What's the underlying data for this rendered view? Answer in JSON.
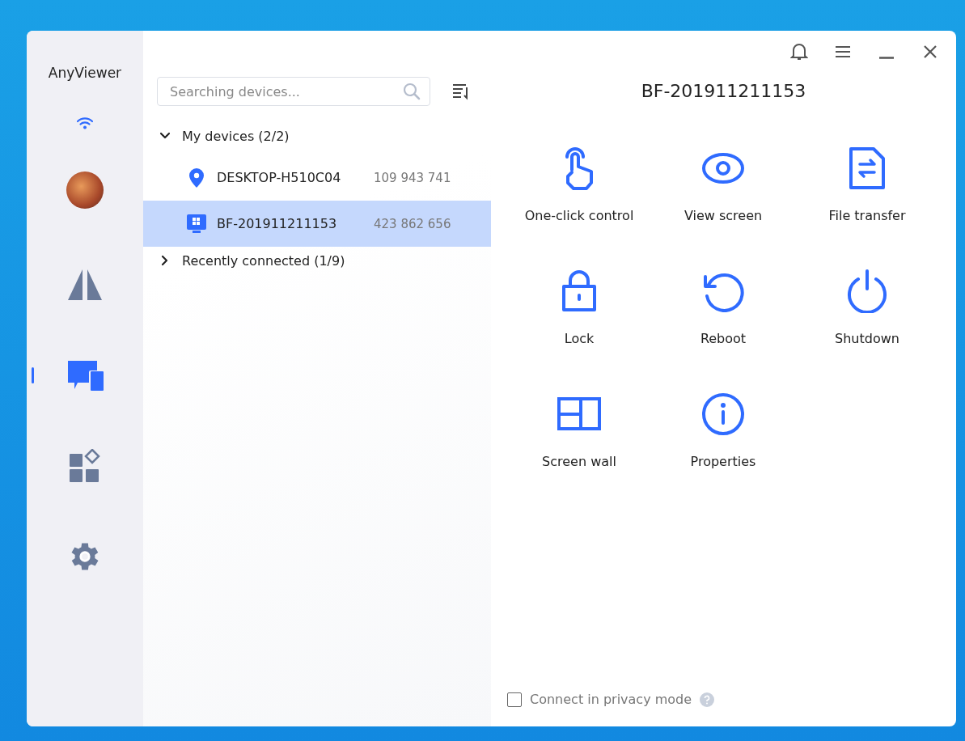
{
  "app": {
    "name": "AnyViewer"
  },
  "sidebar": {
    "items": [
      {
        "kind": "connect",
        "selected": false
      },
      {
        "kind": "devices",
        "selected": true
      },
      {
        "kind": "apps",
        "selected": false
      },
      {
        "kind": "settings",
        "selected": false
      }
    ]
  },
  "search": {
    "placeholder": "Searching devices..."
  },
  "groups": [
    {
      "label": "My devices (2/2)",
      "expanded": true,
      "devices": [
        {
          "kind": "location",
          "name": "DESKTOP-H510C04",
          "id": "109 943 741",
          "selected": false
        },
        {
          "kind": "computer",
          "name": "BF-201911211153",
          "id": "423 862 656",
          "selected": true
        }
      ]
    },
    {
      "label": "Recently connected (1/9)",
      "expanded": false
    }
  ],
  "detail": {
    "title": "BF-201911211153",
    "actions": [
      {
        "kind": "touch",
        "label": "One-click control"
      },
      {
        "kind": "eye",
        "label": "View screen"
      },
      {
        "kind": "file",
        "label": "File transfer"
      },
      {
        "kind": "lock",
        "label": "Lock"
      },
      {
        "kind": "reboot",
        "label": "Reboot"
      },
      {
        "kind": "power",
        "label": "Shutdown"
      },
      {
        "kind": "wall",
        "label": "Screen wall"
      },
      {
        "kind": "info",
        "label": "Properties"
      }
    ],
    "privacy": {
      "label": "Connect in privacy mode",
      "checked": false
    }
  }
}
